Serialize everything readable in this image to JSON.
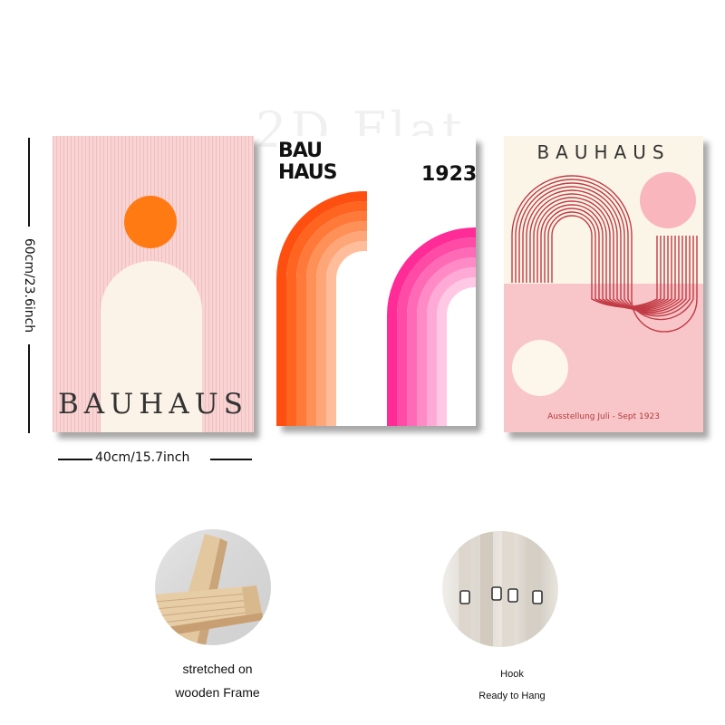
{
  "watermark": "2D Flat",
  "dimensions": {
    "height_label": "60cm/23.6inch",
    "width_label": "40cm/15.7inch"
  },
  "posters": [
    {
      "title": "BAUHAUS",
      "colors": {
        "background": "#f8d4d4",
        "sun": "#ff7a12",
        "arch": "#fbf3e8"
      }
    },
    {
      "title_line1": "BAU",
      "title_line2": "HAUS",
      "year": "1923",
      "colors": {
        "orange": "#ff5a12",
        "pink": "#ff2f9a"
      }
    },
    {
      "title": "BAUHAUS",
      "caption": "Ausstellung Juli - Sept 1923",
      "colors": {
        "lines": "#c23a44",
        "circle": "#f9b6bd",
        "band": "#f8c6c9"
      }
    }
  ],
  "features": [
    {
      "line1": "stretched on",
      "line2": "wooden Frame"
    },
    {
      "line1": "Hook",
      "line2": "Ready to Hang"
    }
  ]
}
